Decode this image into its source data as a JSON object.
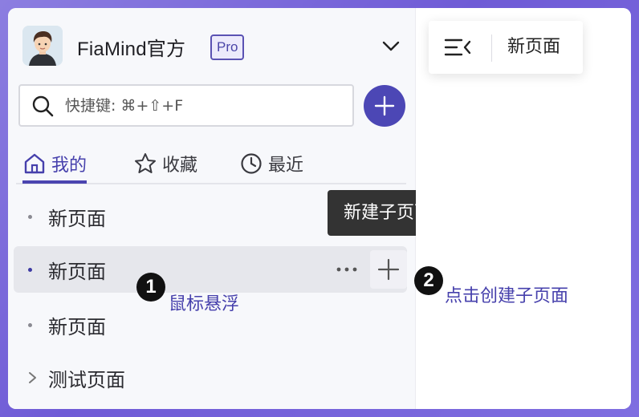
{
  "workspace": {
    "name": "FiaMind官方",
    "badge": "Pro"
  },
  "search": {
    "placeholder": "快捷键: ⌘+⇧+F"
  },
  "tabs": [
    {
      "label": "我的",
      "icon": "home-icon",
      "active": true
    },
    {
      "label": "收藏",
      "icon": "star-icon",
      "active": false
    },
    {
      "label": "最近",
      "icon": "clock-icon",
      "active": false
    }
  ],
  "pages": [
    {
      "label": "新页面"
    },
    {
      "label": "新页面",
      "state": "hover"
    },
    {
      "label": "新页面"
    },
    {
      "label": "测试页面",
      "expandable": true
    }
  ],
  "tooltip": {
    "text": "新建子页面"
  },
  "annotations": [
    {
      "number": "1",
      "text": "鼠标悬浮"
    },
    {
      "number": "2",
      "text": "点击创建子页面"
    }
  ],
  "main": {
    "title": "新页面"
  },
  "colors": {
    "accent": "#4b45b0",
    "tooltip_bg": "#333333",
    "hover_bg": "#e6e7ec"
  }
}
